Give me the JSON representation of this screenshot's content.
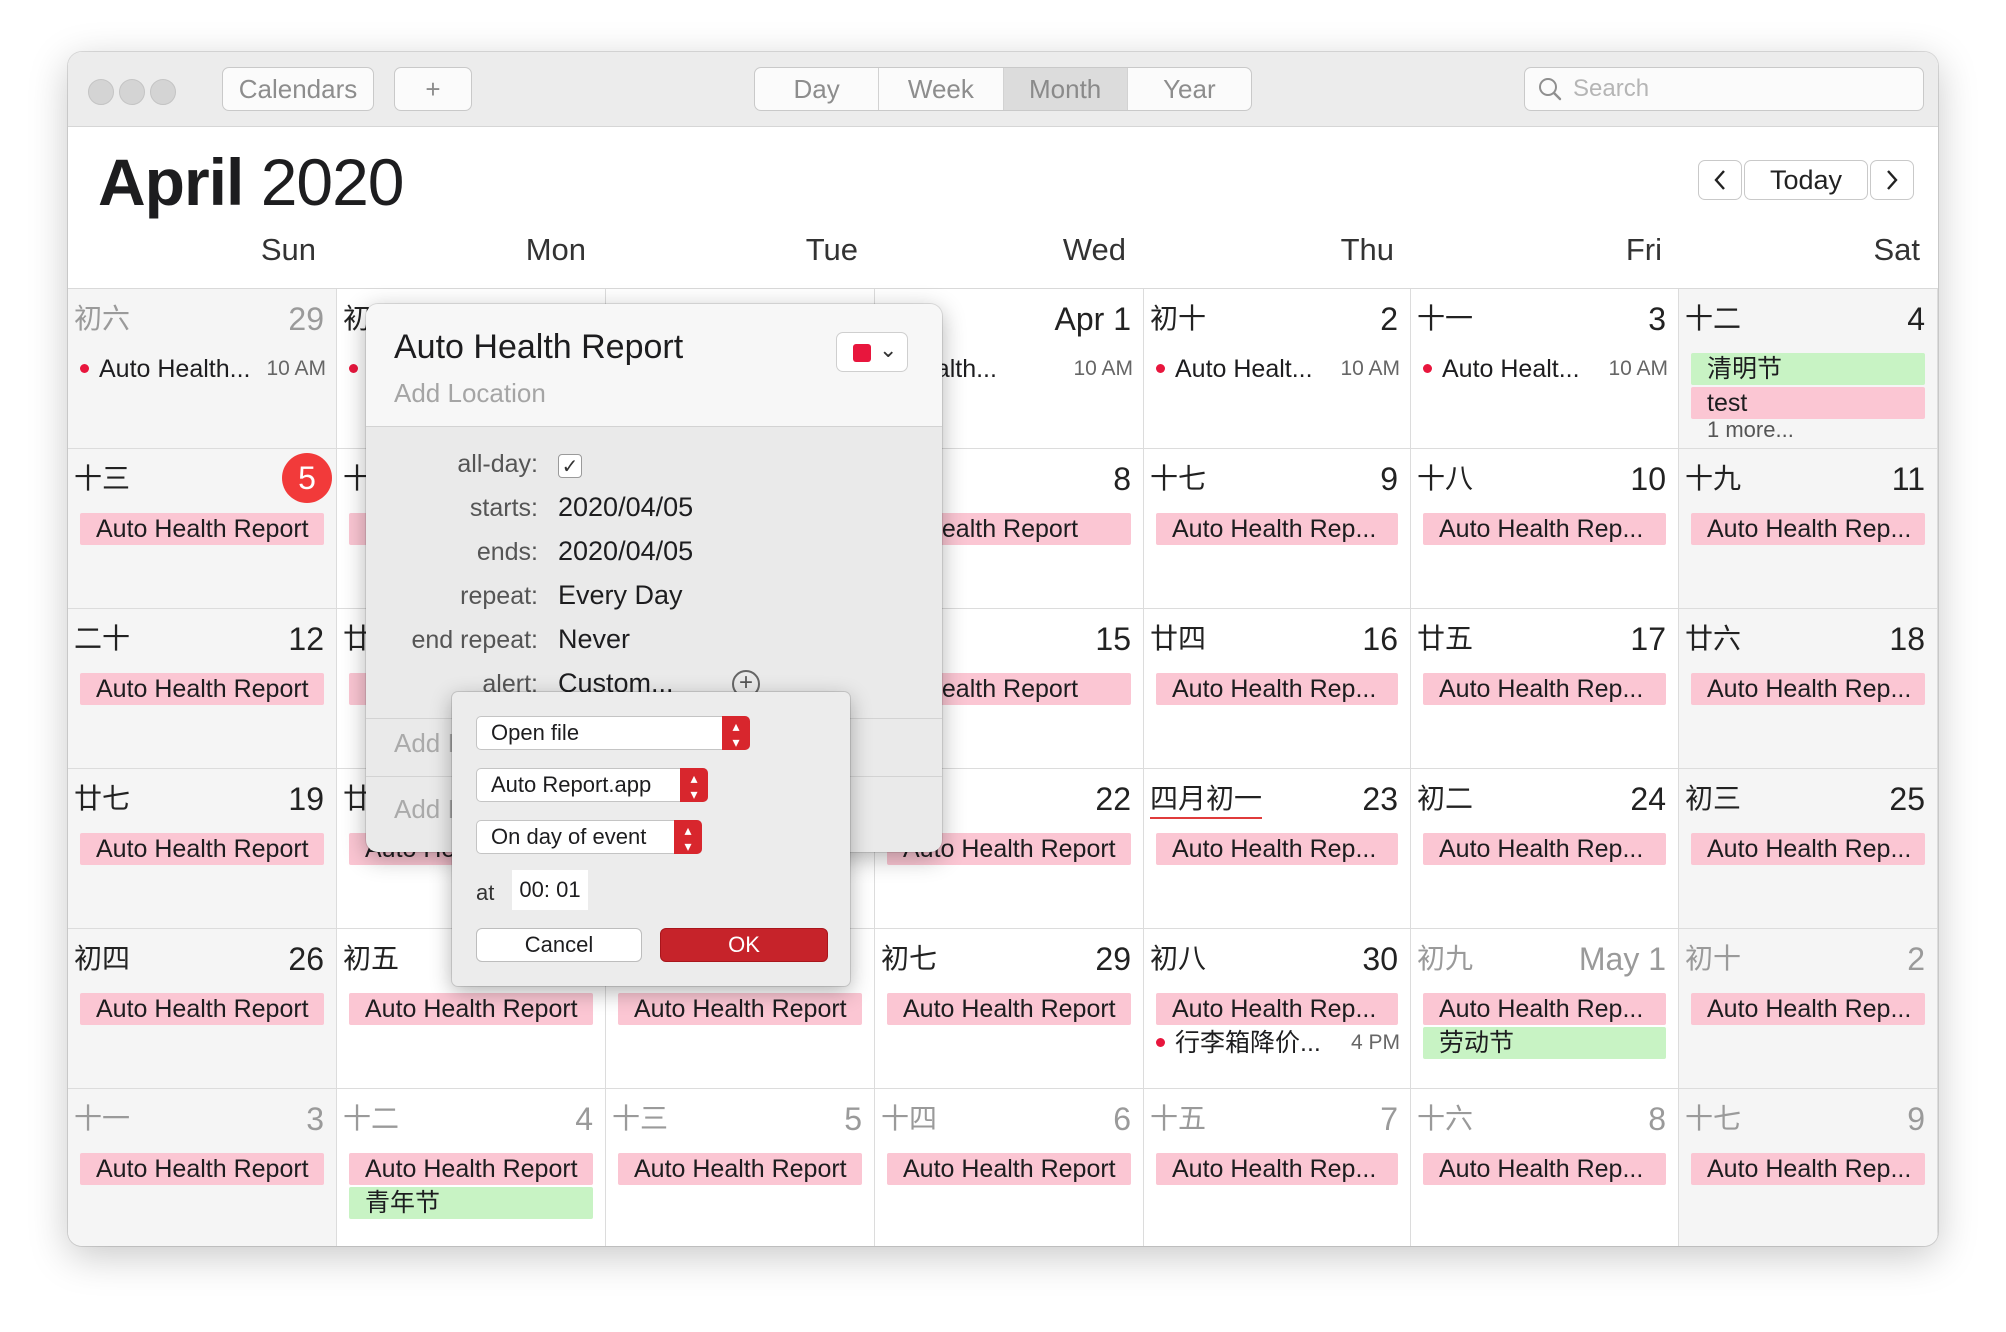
{
  "toolbar": {
    "calendars_label": "Calendars",
    "add_label": "+",
    "views": [
      "Day",
      "Week",
      "Month",
      "Year"
    ],
    "active_view": "Month",
    "search_placeholder": "Search"
  },
  "header": {
    "month": "April",
    "year": "2020",
    "today_label": "Today",
    "prev_label": "‹",
    "next_label": "›"
  },
  "weekdays": [
    "Sun",
    "Mon",
    "Tue",
    "Wed",
    "Thu",
    "Fri",
    "Sat"
  ],
  "colors": {
    "event_pink": "#fbc6d3",
    "holiday_green": "#c8f3c4",
    "today_red": "#f23a3a",
    "calendar_red": "#e8163d"
  },
  "weeks": [
    [
      {
        "lunar": "初六",
        "day": "29",
        "dim": true,
        "events": [
          {
            "kind": "dot",
            "text": "Auto Health...",
            "time": "10 AM"
          }
        ]
      },
      {
        "lunar": "初",
        "day": "",
        "dim": false,
        "events": [
          {
            "kind": "dot",
            "text": "",
            "time": ""
          }
        ]
      },
      {
        "lunar": "",
        "day": "",
        "dim": false,
        "events": []
      },
      {
        "lunar": "",
        "day": "Apr 1",
        "dim": false,
        "events": [
          {
            "kind": "dot",
            "text": "o Health...",
            "time": "10 AM",
            "nodot": true
          }
        ]
      },
      {
        "lunar": "初十",
        "day": "2",
        "dim": false,
        "events": [
          {
            "kind": "dot",
            "text": "Auto Healt...",
            "time": "10 AM"
          }
        ]
      },
      {
        "lunar": "十一",
        "day": "3",
        "dim": false,
        "events": [
          {
            "kind": "dot",
            "text": "Auto Healt...",
            "time": "10 AM"
          }
        ]
      },
      {
        "lunar": "十二",
        "day": "4",
        "dim": false,
        "events": [
          {
            "kind": "bar",
            "text": "清明节",
            "green": true
          },
          {
            "kind": "bar",
            "text": "test"
          }
        ],
        "more": "1 more..."
      }
    ],
    [
      {
        "lunar": "十三",
        "day": "5",
        "today": true,
        "events": [
          {
            "kind": "bar",
            "text": "Auto Health Report"
          }
        ]
      },
      {
        "lunar": "十",
        "day": "",
        "events": [
          {
            "kind": "bar",
            "text": ""
          }
        ]
      },
      {
        "lunar": "",
        "day": "",
        "events": []
      },
      {
        "lunar": "",
        "day": "8",
        "events": [
          {
            "kind": "bar",
            "text": "o Health Report"
          }
        ]
      },
      {
        "lunar": "十七",
        "day": "9",
        "events": [
          {
            "kind": "bar",
            "text": "Auto Health Rep..."
          }
        ]
      },
      {
        "lunar": "十八",
        "day": "10",
        "events": [
          {
            "kind": "bar",
            "text": "Auto Health Rep..."
          }
        ]
      },
      {
        "lunar": "十九",
        "day": "11",
        "events": [
          {
            "kind": "bar",
            "text": "Auto Health Rep..."
          }
        ]
      }
    ],
    [
      {
        "lunar": "二十",
        "day": "12",
        "events": [
          {
            "kind": "bar",
            "text": "Auto Health Report"
          }
        ]
      },
      {
        "lunar": "廿",
        "day": "",
        "events": [
          {
            "kind": "bar",
            "text": ""
          }
        ]
      },
      {
        "lunar": "",
        "day": "",
        "events": []
      },
      {
        "lunar": "",
        "day": "15",
        "events": [
          {
            "kind": "bar",
            "text": "o Health Report"
          }
        ]
      },
      {
        "lunar": "廿四",
        "day": "16",
        "events": [
          {
            "kind": "bar",
            "text": "Auto Health Rep..."
          }
        ]
      },
      {
        "lunar": "廿五",
        "day": "17",
        "events": [
          {
            "kind": "bar",
            "text": "Auto Health Rep..."
          }
        ]
      },
      {
        "lunar": "廿六",
        "day": "18",
        "events": [
          {
            "kind": "bar",
            "text": "Auto Health Rep..."
          }
        ]
      }
    ],
    [
      {
        "lunar": "廿七",
        "day": "19",
        "events": [
          {
            "kind": "bar",
            "text": "Auto Health Report"
          }
        ]
      },
      {
        "lunar": "廿",
        "day": "",
        "events": [
          {
            "kind": "bar",
            "text": "Auto He"
          }
        ]
      },
      {
        "lunar": "",
        "day": "",
        "events": []
      },
      {
        "lunar": "",
        "day": "22",
        "events": [
          {
            "kind": "bar",
            "text": "Auto Health Report"
          }
        ]
      },
      {
        "lunar": "四月初一",
        "day": "23",
        "redline": true,
        "events": [
          {
            "kind": "bar",
            "text": "Auto Health Rep..."
          }
        ]
      },
      {
        "lunar": "初二",
        "day": "24",
        "events": [
          {
            "kind": "bar",
            "text": "Auto Health Rep..."
          }
        ]
      },
      {
        "lunar": "初三",
        "day": "25",
        "events": [
          {
            "kind": "bar",
            "text": "Auto Health Rep..."
          }
        ]
      }
    ],
    [
      {
        "lunar": "初四",
        "day": "26",
        "events": [
          {
            "kind": "bar",
            "text": "Auto Health Report"
          }
        ]
      },
      {
        "lunar": "初五",
        "day": "",
        "events": [
          {
            "kind": "bar",
            "text": "Auto Health Report"
          }
        ]
      },
      {
        "lunar": "",
        "day": "",
        "events": [
          {
            "kind": "bar",
            "text": "Auto Health Report"
          }
        ]
      },
      {
        "lunar": "初七",
        "day": "29",
        "events": [
          {
            "kind": "bar",
            "text": "Auto Health Report"
          }
        ]
      },
      {
        "lunar": "初八",
        "day": "30",
        "events": [
          {
            "kind": "bar",
            "text": "Auto Health Rep..."
          },
          {
            "kind": "dot",
            "text": "行李箱降价...",
            "time": "4 PM"
          }
        ]
      },
      {
        "lunar": "初九",
        "day": "May 1",
        "dim": true,
        "events": [
          {
            "kind": "bar",
            "text": "Auto Health Rep..."
          },
          {
            "kind": "bar",
            "text": "劳动节",
            "green": true
          }
        ]
      },
      {
        "lunar": "初十",
        "day": "2",
        "dim": true,
        "events": [
          {
            "kind": "bar",
            "text": "Auto Health Rep..."
          }
        ]
      }
    ],
    [
      {
        "lunar": "十一",
        "day": "3",
        "dim": true,
        "events": [
          {
            "kind": "bar",
            "text": "Auto Health Report"
          }
        ]
      },
      {
        "lunar": "十二",
        "day": "4",
        "dim": true,
        "events": [
          {
            "kind": "bar",
            "text": "Auto Health Report"
          },
          {
            "kind": "bar",
            "text": "青年节",
            "green": true
          }
        ]
      },
      {
        "lunar": "十三",
        "day": "5",
        "dim": true,
        "events": [
          {
            "kind": "bar",
            "text": "Auto Health Report"
          }
        ]
      },
      {
        "lunar": "十四",
        "day": "6",
        "dim": true,
        "events": [
          {
            "kind": "bar",
            "text": "Auto Health Report"
          }
        ]
      },
      {
        "lunar": "十五",
        "day": "7",
        "dim": true,
        "events": [
          {
            "kind": "bar",
            "text": "Auto Health Rep..."
          }
        ]
      },
      {
        "lunar": "十六",
        "day": "8",
        "dim": true,
        "events": [
          {
            "kind": "bar",
            "text": "Auto Health Rep..."
          }
        ]
      },
      {
        "lunar": "十七",
        "day": "9",
        "dim": true,
        "events": [
          {
            "kind": "bar",
            "text": "Auto Health Rep..."
          }
        ]
      }
    ]
  ],
  "popover": {
    "title": "Auto Health Report",
    "location_placeholder": "Add Location",
    "fields": {
      "allday_label": "all-day:",
      "allday_checked": "✓",
      "starts_label": "starts:",
      "starts_value": "2020/04/05",
      "ends_label": "ends:",
      "ends_value": "2020/04/05",
      "repeat_label": "repeat:",
      "repeat_value": "Every Day",
      "end_repeat_label": "end repeat:",
      "end_repeat_value": "Never",
      "alert_label": "alert:",
      "alert_value": "Custom..."
    },
    "add_row_1": "Add I",
    "add_row_2": "Add I"
  },
  "alert_panel": {
    "action": "Open file",
    "file": "Auto Report.app",
    "when": "On day of event",
    "at_label": "at",
    "time": "00: 01",
    "cancel_label": "Cancel",
    "ok_label": "OK"
  }
}
